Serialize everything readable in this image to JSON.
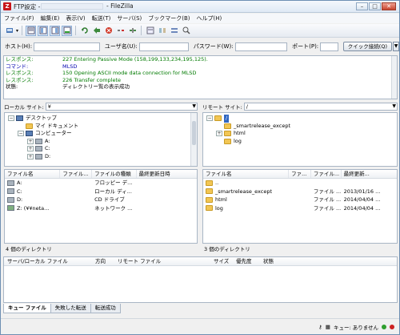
{
  "window": {
    "title_prefix": "FTP設定 -",
    "title_suffix": "- FileZilla",
    "app_icon_letter": "Z"
  },
  "menu": [
    "ファイル(F)",
    "編集(E)",
    "表示(V)",
    "転送(T)",
    "サーバ(S)",
    "ブックマーク(B)",
    "ヘルプ(H)"
  ],
  "quickconnect": {
    "host_label": "ホスト(H):",
    "user_label": "ユーザ名(U):",
    "pass_label": "パスワード(W):",
    "port_label": "ポート(P):",
    "button": "クイック接続(Q)",
    "dropdown": "▼"
  },
  "log": [
    {
      "type": "レスポンス:",
      "msg": "227 Entering Passive Mode (158,199,133,234,195,125).",
      "color": "green"
    },
    {
      "type": "コマンド:",
      "msg": "MLSD",
      "color": "blue"
    },
    {
      "type": "レスポンス:",
      "msg": "150 Opening ASCII mode data connection for MLSD",
      "color": "green"
    },
    {
      "type": "レスポンス:",
      "msg": "226 Transfer complete",
      "color": "green"
    },
    {
      "type": "状態:",
      "msg": "ディレクトリー覧の表示成功",
      "color": "black"
    }
  ],
  "local": {
    "site_label": "ローカル サイト:",
    "site_path": "¥",
    "tree": [
      {
        "label": "デスクトップ",
        "icon": "desktop",
        "indent": 0,
        "exp": "−"
      },
      {
        "label": "マイ ドキュメント",
        "icon": "folder",
        "indent": 1,
        "exp": ""
      },
      {
        "label": "コンピューター",
        "icon": "computer",
        "indent": 1,
        "exp": "−"
      },
      {
        "label": "A:",
        "icon": "drive",
        "indent": 2,
        "exp": "+"
      },
      {
        "label": "C:",
        "icon": "drive",
        "indent": 2,
        "exp": "+"
      },
      {
        "label": "D:",
        "icon": "drive",
        "indent": 2,
        "exp": "+"
      }
    ],
    "headers": [
      "ファイル名",
      "ファイル...",
      "ファイルの種類",
      "最終更新日時"
    ],
    "files": [
      {
        "name": "A:",
        "size": "",
        "type": "フロッピー デ...",
        "date": ""
      },
      {
        "name": "C:",
        "size": "",
        "type": "ローカル ディ...",
        "date": ""
      },
      {
        "name": "D:",
        "size": "",
        "type": "CD ドライブ",
        "date": ""
      },
      {
        "name": "Z: (¥¥neta...",
        "size": "",
        "type": "ネットワーク ...",
        "date": ""
      }
    ],
    "status": "4 個のディレクトリ"
  },
  "remote": {
    "site_label": "リモート サイト:",
    "site_path": "/",
    "tree": [
      {
        "label": "/",
        "icon": "folder",
        "indent": 0,
        "exp": "−"
      },
      {
        "label": "_smartrelease_except",
        "icon": "folder",
        "indent": 1,
        "exp": ""
      },
      {
        "label": "html",
        "icon": "folder",
        "indent": 1,
        "exp": "+"
      },
      {
        "label": "log",
        "icon": "folder",
        "indent": 1,
        "exp": ""
      }
    ],
    "headers": [
      "ファイル名",
      "ファ...",
      "ファイル...",
      "最終更新..."
    ],
    "files": [
      {
        "name": "..",
        "size": "",
        "type": "",
        "date": ""
      },
      {
        "name": "_smartrelease_except",
        "size": "",
        "type": "ファイル ...",
        "date": "2013/01/16 ..."
      },
      {
        "name": "html",
        "size": "",
        "type": "ファイル ...",
        "date": "2014/04/04 ..."
      },
      {
        "name": "log",
        "size": "",
        "type": "ファイル ...",
        "date": "2014/04/04 ..."
      }
    ],
    "status": "3 個のディレクトリ"
  },
  "queue": {
    "headers": [
      "サーバ/ローカル ファイル",
      "方向",
      "リモート ファイル",
      "サイズ",
      "優先度",
      "状態"
    ],
    "tabs": [
      "キュー ファイル",
      "失敗した転送",
      "転送成功"
    ]
  },
  "statusbar": {
    "queue_text": "キュー: ありません"
  },
  "colors": {
    "log_green": "#007a00",
    "log_blue": "#0000b0",
    "dot_green": "#2e9e2e",
    "dot_red": "#cc2020"
  }
}
